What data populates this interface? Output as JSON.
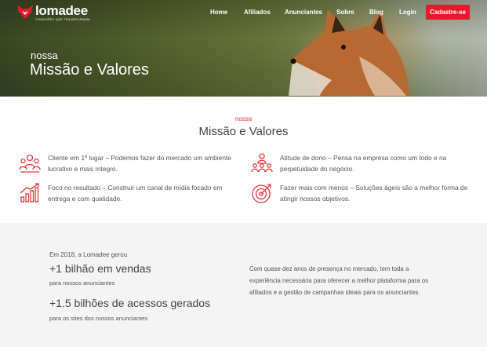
{
  "nav": {
    "brand": "lomadee",
    "tagline": "CONEXÕES QUE TRANSFORMAM",
    "links": [
      "Home",
      "Afiliados",
      "Anunciantes",
      "Sobre",
      "Blog",
      "Login"
    ],
    "cta": "Cadastre-se"
  },
  "hero": {
    "subtitle": "nossa",
    "title": "Missão e Valores"
  },
  "mission": {
    "subtitle": "nossa",
    "title": "Missão e Valores",
    "values": [
      {
        "icon": "team-leader-icon",
        "text": "Cliente em 1º lugar – Podemos fazer do mercado um ambiente lucrativo e mais íntegro."
      },
      {
        "icon": "ownership-icon",
        "text": "Atitude de dono – Pensa na empresa como um todo e na perpetuidade do negócio."
      },
      {
        "icon": "growth-chart-icon",
        "text": "Foco no resultado – Construir um canal de mídia focado em entrega e com qualidade."
      },
      {
        "icon": "target-icon",
        "text": "Fazer mais com menos – Soluções ágeis são a melhor forma de atingir nossos objetivos."
      }
    ]
  },
  "stats": {
    "intro": "Em 2018, a Lomadee gerou",
    "sales": "+1 bilhão em vendas",
    "sales_note": "para nossos anunciantes",
    "access": "+1.5 bilhões de acessos gerados",
    "access_note": "para os sites dos nossos anunciantes",
    "paragraph": "Com quase dez anos de presença no mercado, tem toda a experiência necessária para oferecer a melhor plataforma para os afiliados e a gestão de campanhas ideais para os anunciantes."
  },
  "colors": {
    "accent": "#e8192c",
    "band": "#f4f4f4"
  }
}
